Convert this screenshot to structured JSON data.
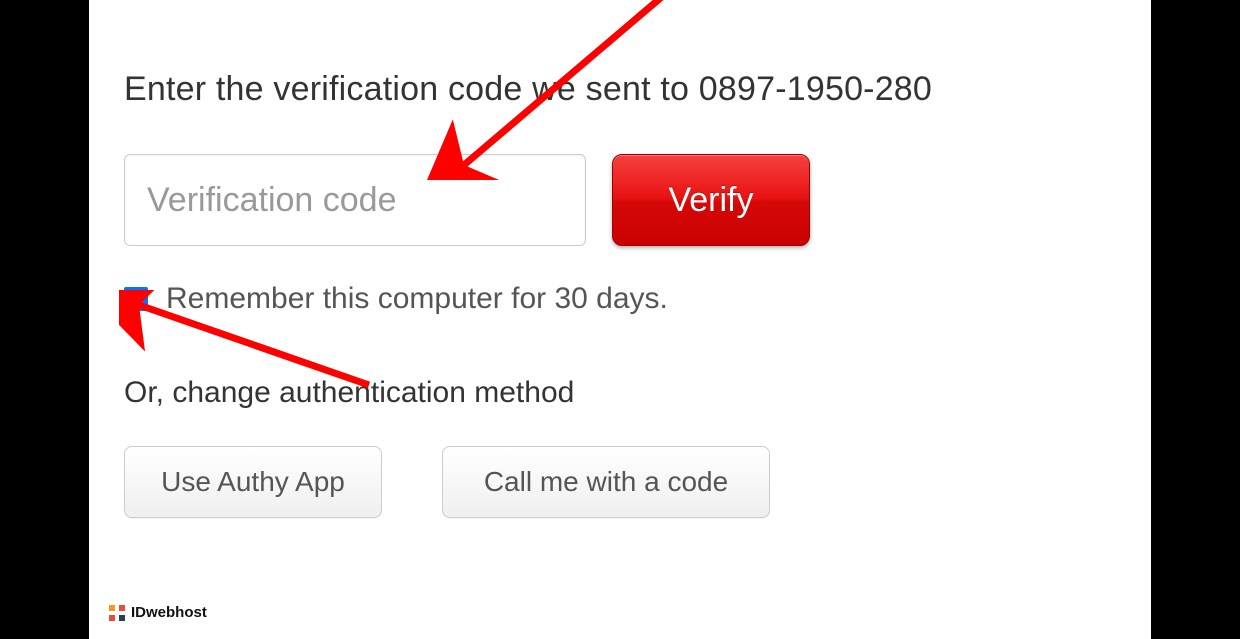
{
  "heading": "Enter the verification code we sent to 0897-1950-280",
  "input": {
    "placeholder": "Verification code",
    "value": ""
  },
  "verify_label": "Verify",
  "remember": {
    "checked": true,
    "label": "Remember this computer for 30 days."
  },
  "or_heading": "Or, change authentication method",
  "alt_buttons": {
    "authy": "Use Authy App",
    "call": "Call me with a code"
  },
  "logo_text": "IDwebhost"
}
